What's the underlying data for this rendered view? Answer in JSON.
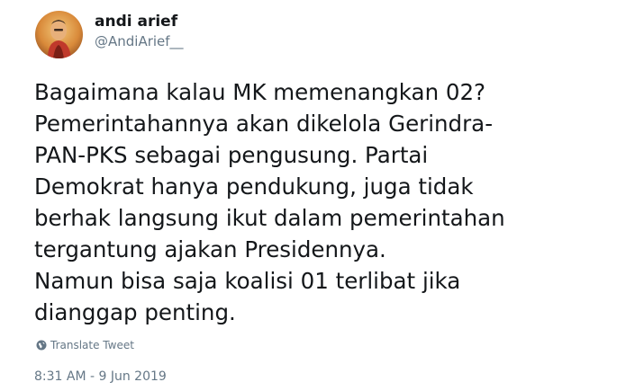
{
  "user": {
    "display_name": "andi arief",
    "handle": "@AndiArief__"
  },
  "tweet": {
    "lines": [
      "Bagaimana kalau MK memenangkan 02?",
      "Pemerintahannya akan dikelola Gerindra-",
      "PAN-PKS sebagai pengusung. Partai",
      "Demokrat hanya pendukung, juga tidak",
      "berhak langsung ikut dalam pemerintahan",
      "tergantung ajakan Presidennya.",
      "Namun bisa saja koalisi 01 terlibat jika",
      "dianggap penting."
    ],
    "translate_label": "Translate Tweet",
    "timestamp": "8:31 AM - 9 Jun 2019"
  },
  "icons": {
    "avatar": "avatar-photo",
    "translate": "globe-icon"
  },
  "colors": {
    "text": "#14171a",
    "secondary": "#657786"
  }
}
